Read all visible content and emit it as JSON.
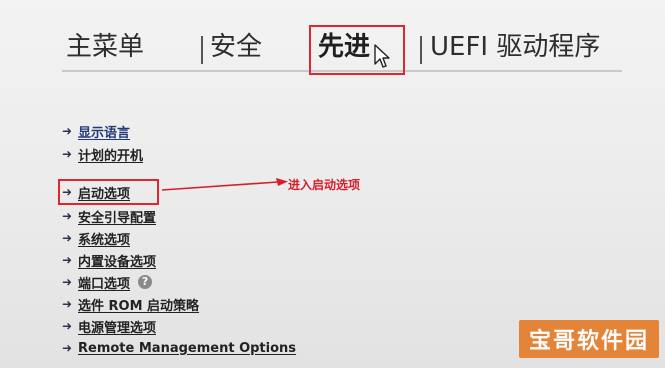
{
  "menu": {
    "tabs": [
      {
        "label": "主菜单"
      },
      {
        "label": "安全"
      },
      {
        "label": "先进"
      },
      {
        "label": "UEFI 驱动程序"
      }
    ]
  },
  "options": [
    {
      "label": "显示语言"
    },
    {
      "label": "计划的开机"
    },
    {
      "label": "启动选项"
    },
    {
      "label": "安全引导配置"
    },
    {
      "label": "系统选项"
    },
    {
      "label": "内置设备选项"
    },
    {
      "label": "端口选项"
    },
    {
      "label": "选件 ROM 启动策略"
    },
    {
      "label": "电源管理选项"
    },
    {
      "label": "Remote Management Options"
    }
  ],
  "help_icon": {
    "glyph": "?"
  },
  "annotation": {
    "text": "进入启动选项"
  },
  "watermark": {
    "text": "宝哥软件园"
  },
  "colors": {
    "highlight": "#e0262f",
    "watermark": "#e57c2a",
    "link": "#233a7a"
  }
}
